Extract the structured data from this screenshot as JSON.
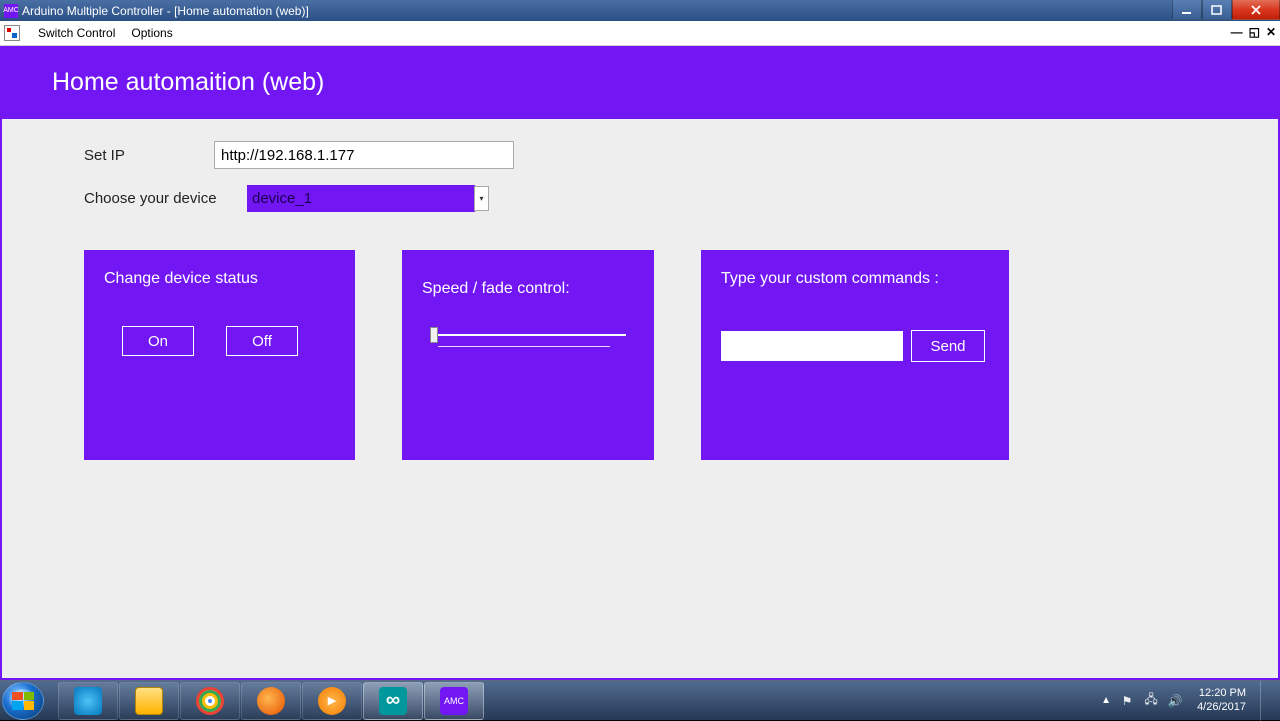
{
  "window": {
    "title": "Arduino Multiple Controller - [Home automation (web)]",
    "app_icon_text": "AMC"
  },
  "menu": {
    "switch_control": "Switch Control",
    "options": "Options"
  },
  "header": {
    "title": "Home automaition (web)"
  },
  "form": {
    "ip_label": "Set IP",
    "ip_value": "http://192.168.1.177",
    "device_label": "Choose your device",
    "device_value": "device_1"
  },
  "cards": {
    "status": {
      "title": "Change device status",
      "on": "On",
      "off": "Off"
    },
    "speed": {
      "title": "Speed / fade control:"
    },
    "custom": {
      "title": "Type your custom commands :",
      "send": "Send",
      "value": ""
    }
  },
  "taskbar": {
    "amc_label": "AMC",
    "time": "12:20 PM",
    "date": "4/26/2017"
  }
}
